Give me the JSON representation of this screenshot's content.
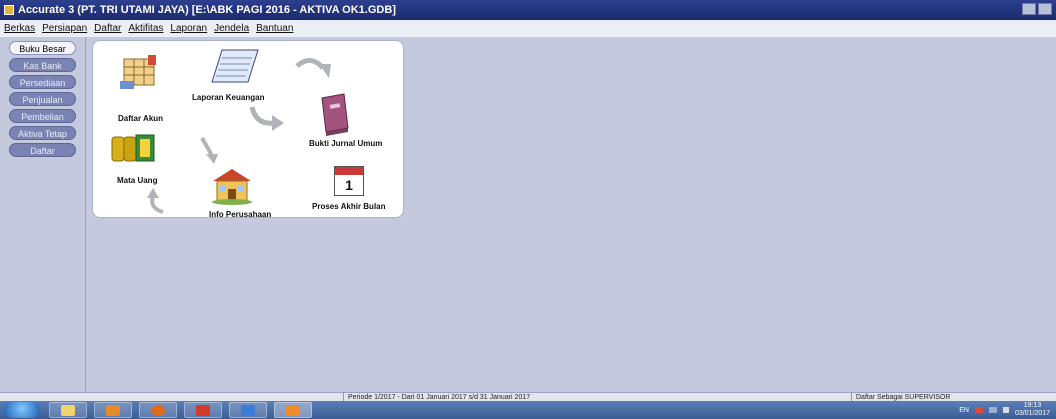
{
  "window": {
    "title": "Accurate 3  (PT. TRI UTAMI JAYA)  [E:\\ABK PAGI 2016 - AKTIVA OK1.GDB]"
  },
  "menu": [
    "Berkas",
    "Persiapan",
    "Daftar",
    "Aktifitas",
    "Laporan",
    "Jendela",
    "Bantuan"
  ],
  "sidebar": {
    "items": [
      {
        "label": "Buku Besar",
        "active": true
      },
      {
        "label": "Kas Bank",
        "active": false
      },
      {
        "label": "Persediaan",
        "active": false
      },
      {
        "label": "Penjualan",
        "active": false
      },
      {
        "label": "Pembelian",
        "active": false
      },
      {
        "label": "Aktiva Tetap",
        "active": false
      },
      {
        "label": "Daftar",
        "active": false
      }
    ]
  },
  "flow": {
    "daftar_akun": "Daftar Akun",
    "laporan_keuangan": "Laporan Keuangan",
    "bukti_jurnal_umum": "Bukti Jurnal Umum",
    "mata_uang": "Mata Uang",
    "info_perusahaan": "Info Perusahaan",
    "proses_akhir_bulan": "Proses Akhir Bulan",
    "calendar_day": "1"
  },
  "status": {
    "periode": "Periode 1/2017 - Dari 01 Januari 2017 s/d 31 Januari 2017",
    "user": "Daftar Sebagai SUPERVISOR"
  },
  "taskbar": {
    "lang": "EN",
    "time": "19:13",
    "date": "03/01/2017"
  },
  "colors": {
    "titlebar": "#1b2a6e",
    "workspace": "#c4c9de",
    "sidebar_button": "#7a84b4"
  }
}
